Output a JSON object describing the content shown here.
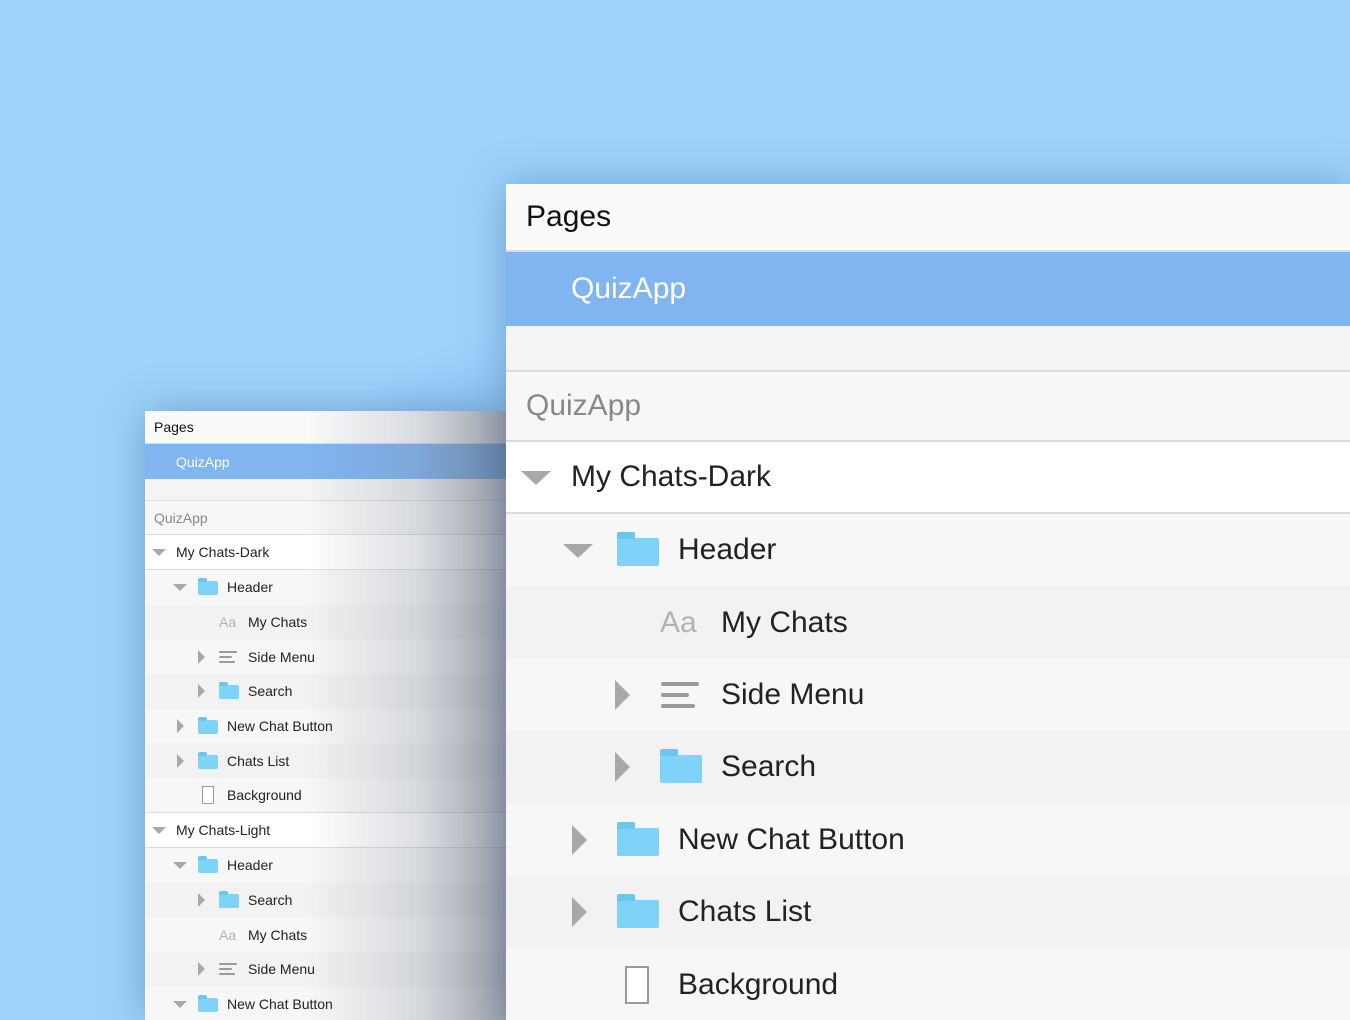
{
  "pages_panel": {
    "title": "Pages",
    "selected_page": "QuizApp",
    "document_name": "QuizApp"
  },
  "layers": [
    {
      "name": "My Chats-Dark",
      "children": [
        {
          "name": "Header",
          "icon": "folder-icon",
          "expanded": true,
          "children": [
            {
              "name": "My Chats",
              "icon": "text-icon"
            },
            {
              "name": "Side Menu",
              "icon": "symbol-lines-icon"
            },
            {
              "name": "Search",
              "icon": "folder-icon"
            }
          ]
        },
        {
          "name": "New Chat Button",
          "icon": "folder-icon"
        },
        {
          "name": "Chats List",
          "icon": "folder-icon"
        },
        {
          "name": "Background",
          "icon": "rectangle-icon"
        }
      ]
    },
    {
      "name": "My Chats-Light",
      "children": [
        {
          "name": "Header",
          "icon": "folder-icon",
          "expanded": true,
          "children": [
            {
              "name": "Search",
              "icon": "folder-icon"
            },
            {
              "name": "My Chats",
              "icon": "text-icon"
            },
            {
              "name": "Side Menu",
              "icon": "symbol-lines-icon"
            }
          ]
        },
        {
          "name": "New Chat Button",
          "icon": "folder-icon"
        }
      ]
    }
  ],
  "text_icon_glyph": "Aa",
  "colors": {
    "background": "#9ed3fc",
    "selection": "#80b5f2",
    "folder": "#7fd3f8"
  }
}
